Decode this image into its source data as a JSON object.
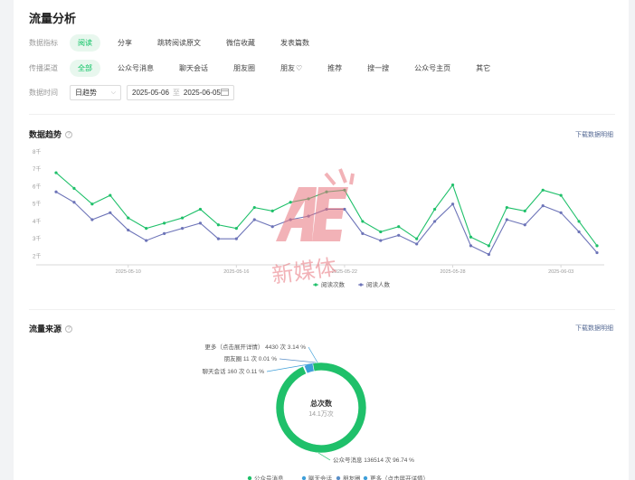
{
  "page_title": "流量分析",
  "metric_row": {
    "label": "数据指标",
    "chips": [
      {
        "label": "阅读",
        "active": true
      },
      {
        "label": "分享",
        "active": false
      },
      {
        "label": "跳转阅读原文",
        "active": false
      },
      {
        "label": "微信收藏",
        "active": false
      },
      {
        "label": "发表篇数",
        "active": false
      }
    ]
  },
  "channel_row": {
    "label": "传播渠道",
    "chips": [
      {
        "label": "全部",
        "active": true
      },
      {
        "label": "公众号消息",
        "active": false
      },
      {
        "label": "聊天会话",
        "active": false
      },
      {
        "label": "朋友圈",
        "active": false
      },
      {
        "label": "朋友",
        "active": false
      },
      {
        "label": "推荐",
        "active": false
      },
      {
        "label": "搜一搜",
        "active": false
      },
      {
        "label": "公众号主页",
        "active": false
      },
      {
        "label": "其它",
        "active": false
      }
    ]
  },
  "time_row": {
    "label": "数据时间",
    "granularity": "日趋势",
    "start_date": "2025-05-06",
    "separator": "至",
    "end_date": "2025-06-05"
  },
  "trend": {
    "title": "数据趋势",
    "download_link": "下载数据明细"
  },
  "source": {
    "title": "流量来源",
    "download_link": "下载数据明细",
    "center_label": "总次数",
    "center_value": "14.1万次"
  },
  "watermark": "新媒体",
  "colors": {
    "green": "#1fc06a",
    "purple": "#6d74b8",
    "blue": "#3f9fd9",
    "gray_blue": "#5b8fc7",
    "active_chip_bg": "#e8f7ee",
    "link": "#576b95"
  },
  "chart_data": [
    {
      "type": "line",
      "ylim": [
        1.5,
        8
      ],
      "y_ticks": [
        "2千",
        "3千",
        "4千",
        "5千",
        "6千",
        "7千",
        "8千"
      ],
      "x_tick_labels": [
        "2025-05-10",
        "2025-05-16",
        "2025-05-22",
        "2025-05-28",
        "2025-06-03"
      ],
      "grid": false,
      "legend_position": "bottom-center",
      "series": [
        {
          "name": "阅读次数",
          "color": "#1fc06a",
          "values": [
            6.8,
            5.9,
            5.0,
            5.5,
            4.2,
            3.6,
            3.9,
            4.2,
            4.7,
            3.8,
            3.6,
            4.8,
            4.6,
            5.1,
            5.3,
            5.7,
            5.8,
            4.0,
            3.4,
            3.7,
            3.0,
            4.7,
            6.1,
            3.1,
            2.6,
            4.8,
            4.6,
            5.8,
            5.5,
            4.0,
            2.6
          ]
        },
        {
          "name": "阅读人数",
          "color": "#6d74b8",
          "values": [
            5.7,
            5.1,
            4.1,
            4.5,
            3.5,
            2.9,
            3.3,
            3.6,
            3.9,
            3.0,
            3.0,
            4.1,
            3.7,
            4.1,
            4.3,
            4.7,
            4.7,
            3.3,
            2.9,
            3.2,
            2.7,
            4.0,
            5.0,
            2.6,
            2.1,
            4.1,
            3.8,
            4.9,
            4.5,
            3.4,
            2.2
          ]
        }
      ]
    },
    {
      "type": "pie",
      "slices": [
        {
          "label": "公众号消息",
          "count": 136514,
          "pct": 96.74,
          "label_text": "公众号消息 136514 次 96.74 %",
          "color": "#1fc06a"
        },
        {
          "label": "聊天会话",
          "count": 160,
          "pct": 0.11,
          "label_text": "聊天会话 160 次 0.11 %",
          "color": "#3f9fd9"
        },
        {
          "label": "朋友圈",
          "count": 11,
          "pct": 0.01,
          "label_text": "朋友圈 11 次 0.01 %",
          "color": "#5b8fc7"
        },
        {
          "label": "更多（点击展开详情）",
          "count": 4430,
          "pct": 3.14,
          "label_text": "更多（点击展开详情） 4430 次 3.14 %",
          "color": "#3f9fd9"
        }
      ],
      "legend_position": "bottom-center"
    }
  ]
}
